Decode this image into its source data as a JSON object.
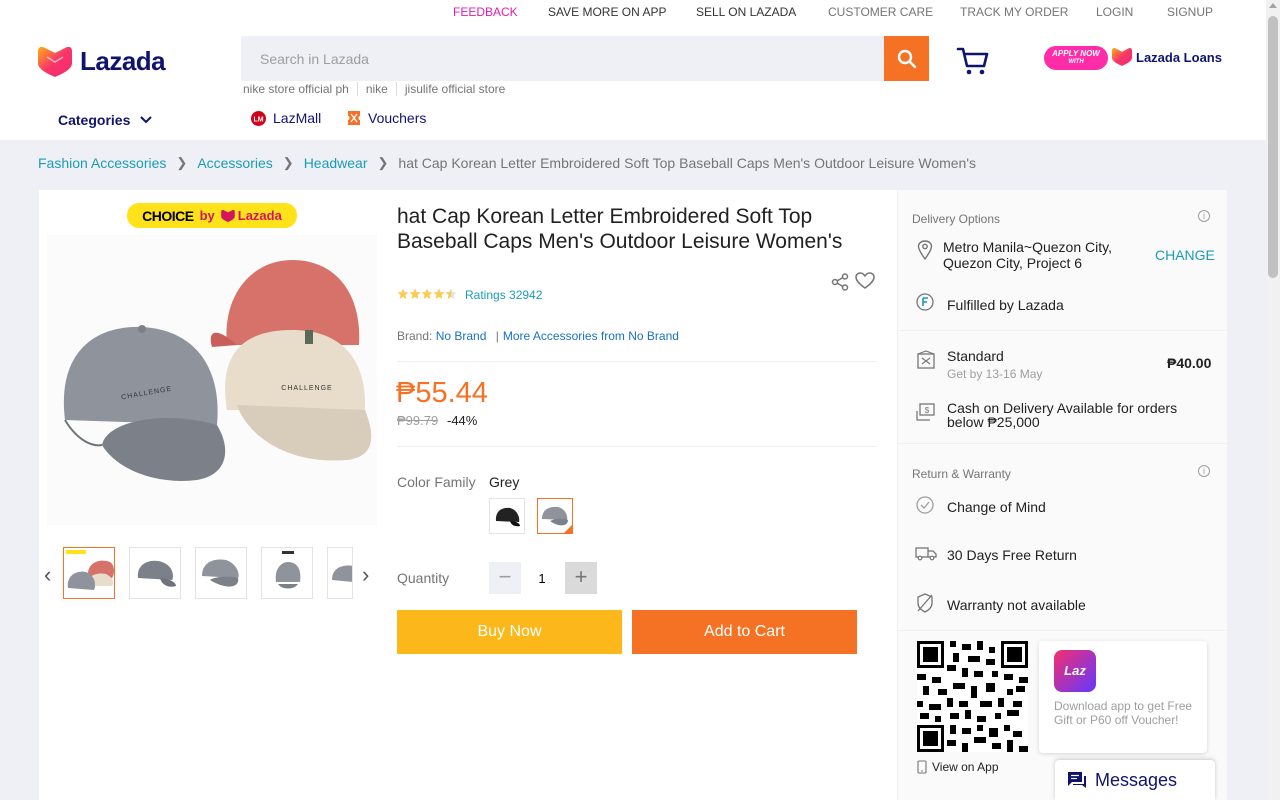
{
  "topbar": {
    "feedback": "FEEDBACK",
    "save_more": "SAVE MORE ON APP",
    "sell": "SELL ON LAZADA",
    "customer_care": "CUSTOMER CARE",
    "track_order": "TRACK MY ORDER",
    "login": "LOGIN",
    "signup": "SIGNUP"
  },
  "header": {
    "logo_text": "Lazada",
    "search_placeholder": "Search in Lazada",
    "suggestions": [
      "nike store official ph",
      "nike",
      "jisulife official store"
    ],
    "apply_now": "APPLY NOW",
    "apply_with": "WITH",
    "loans_text": "Lazada Loans",
    "categories": "Categories",
    "lazmall": "LazMall",
    "vouchers": "Vouchers"
  },
  "breadcrumb": {
    "items": [
      "Fashion Accessories",
      "Accessories",
      "Headwear"
    ],
    "current": "hat Cap Korean Letter Embroidered Soft Top Baseball Caps Men's Outdoor Leisure Women's"
  },
  "product": {
    "choice_text": "CHOICE",
    "choice_by": "by",
    "choice_brand": "Lazada",
    "title": "hat Cap Korean Letter Embroidered Soft Top Baseball Caps Men's Outdoor Leisure Women's",
    "rating_stars": 4.5,
    "ratings": "Ratings 32942",
    "brand_label": "Brand:",
    "brand_value": "No Brand",
    "more_from": "More Accessories from No Brand",
    "price": "₱55.44",
    "old_price": "₱99.79",
    "discount": "-44%",
    "color_label": "Color Family",
    "color_value": "Grey",
    "quantity_label": "Quantity",
    "quantity_value": "1",
    "buy_now": "Buy Now",
    "add_to_cart": "Add to Cart",
    "cap_text": "CHALLENGE"
  },
  "delivery": {
    "heading": "Delivery Options",
    "location": "Metro Manila~Quezon City, Quezon City, Project 6",
    "change": "CHANGE",
    "fulfilled": "Fulfilled by Lazada",
    "standard": "Standard",
    "standard_eta": "Get by 13-16 May",
    "standard_price": "₱40.00",
    "cod": "Cash on Delivery Available for orders below ₱25,000",
    "return_heading": "Return & Warranty",
    "change_of_mind": "Change of Mind",
    "free_return": "30 Days Free Return",
    "warranty": "Warranty not available",
    "view_on_app": "View on App",
    "app_icon": "Laz",
    "app_promo": "Download app to get Free Gift or P60 off Voucher!",
    "messages": "Messages"
  },
  "colors": {
    "accent": "#f57224",
    "link": "#1a9cb7",
    "navy": "#0f146d",
    "buy": "#fcb71a"
  }
}
